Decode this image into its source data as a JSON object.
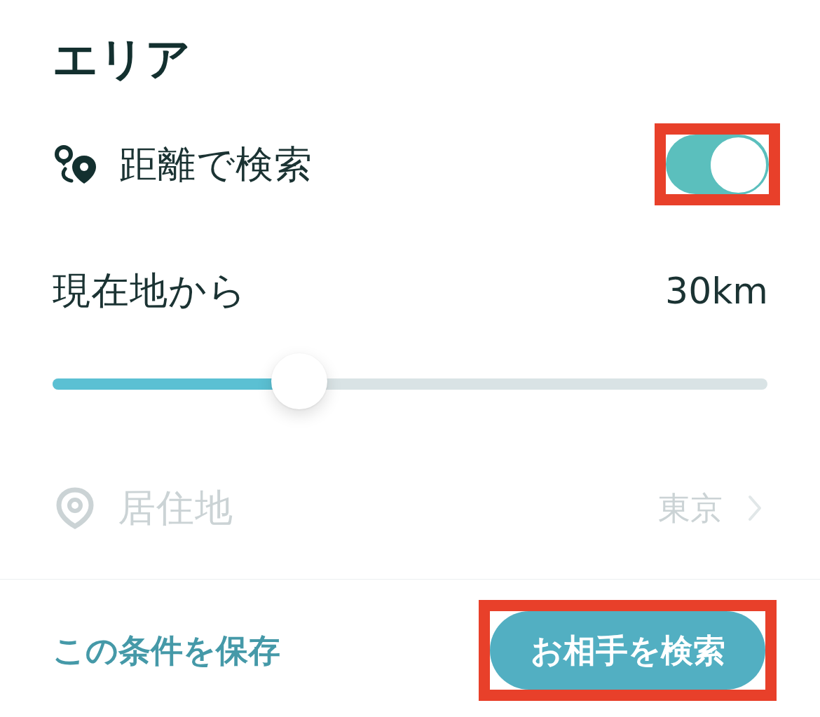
{
  "section": {
    "title": "エリア"
  },
  "distance_search": {
    "label": "距離で検索",
    "on": true,
    "highlighted": true
  },
  "distance": {
    "label": "現在地から",
    "value": "30km",
    "level": 0.345
  },
  "residence": {
    "label": "居住地",
    "value": "東京",
    "disabled": true
  },
  "footer": {
    "save_link": "この条件を保存",
    "search_button": {
      "label": "お相手を検索",
      "highlighted": true
    }
  }
}
